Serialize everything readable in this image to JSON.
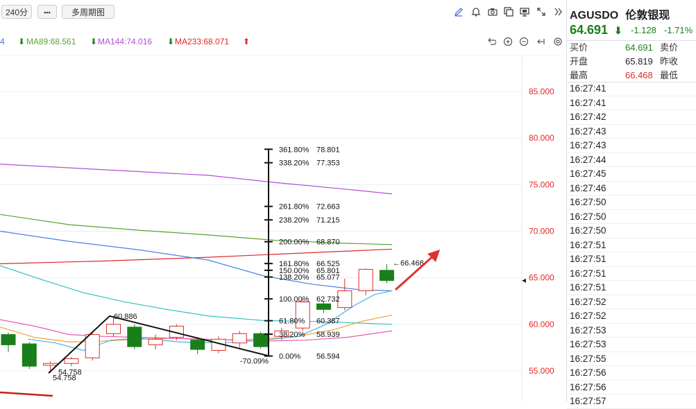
{
  "toolbar": {
    "timeframe": "240分",
    "more": "▪▪▪",
    "multi_period": "多周期图",
    "icons": [
      "pencil-icon",
      "bell-icon",
      "camera-icon",
      "copy-icon",
      "monitor-icon",
      "expand-icon",
      "collapse-panel-icon"
    ]
  },
  "ma": {
    "prefix": "4",
    "ma89": "MA89:68.561",
    "ma144": "MA144:74.016",
    "ma233": "MA233:68.071",
    "colors": {
      "ma89": "#5aa22f",
      "ma144": "#b24fd6",
      "ma233": "#e02828",
      "down": "#1a7f1a",
      "up": "#e02828"
    }
  },
  "chart_data": {
    "type": "candlestick",
    "yaxis_ticks": [
      85,
      80,
      75,
      70,
      65,
      60,
      55
    ],
    "yaxis_labels": [
      "85.000",
      "80.000",
      "75.000",
      "70.000",
      "65.000",
      "60.000",
      "55.000"
    ],
    "fib_levels": [
      {
        "pct": "361.80%",
        "val": "78.801",
        "price": 78.801
      },
      {
        "pct": "338.20%",
        "val": "77.353",
        "price": 77.353
      },
      {
        "pct": "261.80%",
        "val": "72.663",
        "price": 72.663
      },
      {
        "pct": "238.20%",
        "val": "71.215",
        "price": 71.215
      },
      {
        "pct": "200.00%",
        "val": "68.870",
        "price": 68.87
      },
      {
        "pct": "161.80%",
        "val": "66.525",
        "price": 66.525
      },
      {
        "pct": "150.00%",
        "val": "65.801",
        "price": 65.801
      },
      {
        "pct": "138.20%",
        "val": "65.077",
        "price": 65.077
      },
      {
        "pct": "100.00%",
        "val": "62.732",
        "price": 62.732
      },
      {
        "pct": "61.80%",
        "val": "60.387",
        "price": 60.387
      },
      {
        "pct": "38.20%",
        "val": "58.939",
        "price": 58.939
      },
      {
        "pct": "0.00%",
        "val": "56.594",
        "price": 56.594
      }
    ],
    "annotations": {
      "high_last": "←66.468",
      "low_a": "54.758",
      "low_b": "54.758",
      "peak": "60.886",
      "fib_low": "56.594",
      "retrace": "-70.09%"
    },
    "candles": [
      {
        "o": 58.9,
        "c": 57.8,
        "h": 59.1,
        "l": 57.0
      },
      {
        "o": 57.9,
        "c": 55.5,
        "h": 58.1,
        "l": 55.2
      },
      {
        "o": 55.6,
        "c": 55.8,
        "h": 56.0,
        "l": 54.8
      },
      {
        "o": 55.8,
        "c": 56.3,
        "h": 56.5,
        "l": 55.5
      },
      {
        "o": 56.4,
        "c": 58.9,
        "h": 59.2,
        "l": 56.1
      },
      {
        "o": 59.0,
        "c": 60.0,
        "h": 60.9,
        "l": 58.7
      },
      {
        "o": 59.7,
        "c": 57.6,
        "h": 60.0,
        "l": 57.3
      },
      {
        "o": 57.8,
        "c": 58.4,
        "h": 58.9,
        "l": 57.3
      },
      {
        "o": 58.6,
        "c": 59.8,
        "h": 60.0,
        "l": 58.3
      },
      {
        "o": 58.3,
        "c": 57.3,
        "h": 58.6,
        "l": 56.8
      },
      {
        "o": 57.2,
        "c": 58.4,
        "h": 58.7,
        "l": 56.9
      },
      {
        "o": 58.0,
        "c": 59.0,
        "h": 59.3,
        "l": 57.5
      },
      {
        "o": 59.0,
        "c": 57.6,
        "h": 59.2,
        "l": 57.4
      },
      {
        "o": 58.7,
        "c": 59.3,
        "h": 59.6,
        "l": 58.3
      },
      {
        "o": 59.6,
        "c": 62.4,
        "h": 62.7,
        "l": 59.3
      },
      {
        "o": 62.2,
        "c": 61.6,
        "h": 62.5,
        "l": 61.2
      },
      {
        "o": 61.8,
        "c": 63.6,
        "h": 64.9,
        "l": 61.5
      },
      {
        "o": 63.6,
        "c": 65.9,
        "h": 66.0,
        "l": 63.1
      },
      {
        "o": 65.8,
        "c": 64.7,
        "h": 66.468,
        "l": 64.4
      }
    ]
  },
  "side": {
    "symbol": "AGUSDO",
    "name": "伦敦银现",
    "price": "64.691",
    "change": "-1.128",
    "change_pct": "-1.71%",
    "rows": [
      {
        "label": "买价",
        "value": "64.691",
        "label2": "卖价",
        "color": "#1a7f1a"
      },
      {
        "label": "开盘",
        "value": "65.819",
        "label2": "昨收",
        "color": "#222"
      },
      {
        "label": "最高",
        "value": "66.468",
        "label2": "最低",
        "color": "#e02828"
      }
    ],
    "times": [
      "16:27:41",
      "16:27:41",
      "16:27:42",
      "16:27:43",
      "16:27:43",
      "16:27:44",
      "16:27:45",
      "16:27:46",
      "16:27:50",
      "16:27:50",
      "16:27:50",
      "16:27:51",
      "16:27:51",
      "16:27:51",
      "16:27:51",
      "16:27:52",
      "16:27:52",
      "16:27:53",
      "16:27:53",
      "16:27:55",
      "16:27:56",
      "16:27:56",
      "16:27:57"
    ]
  }
}
